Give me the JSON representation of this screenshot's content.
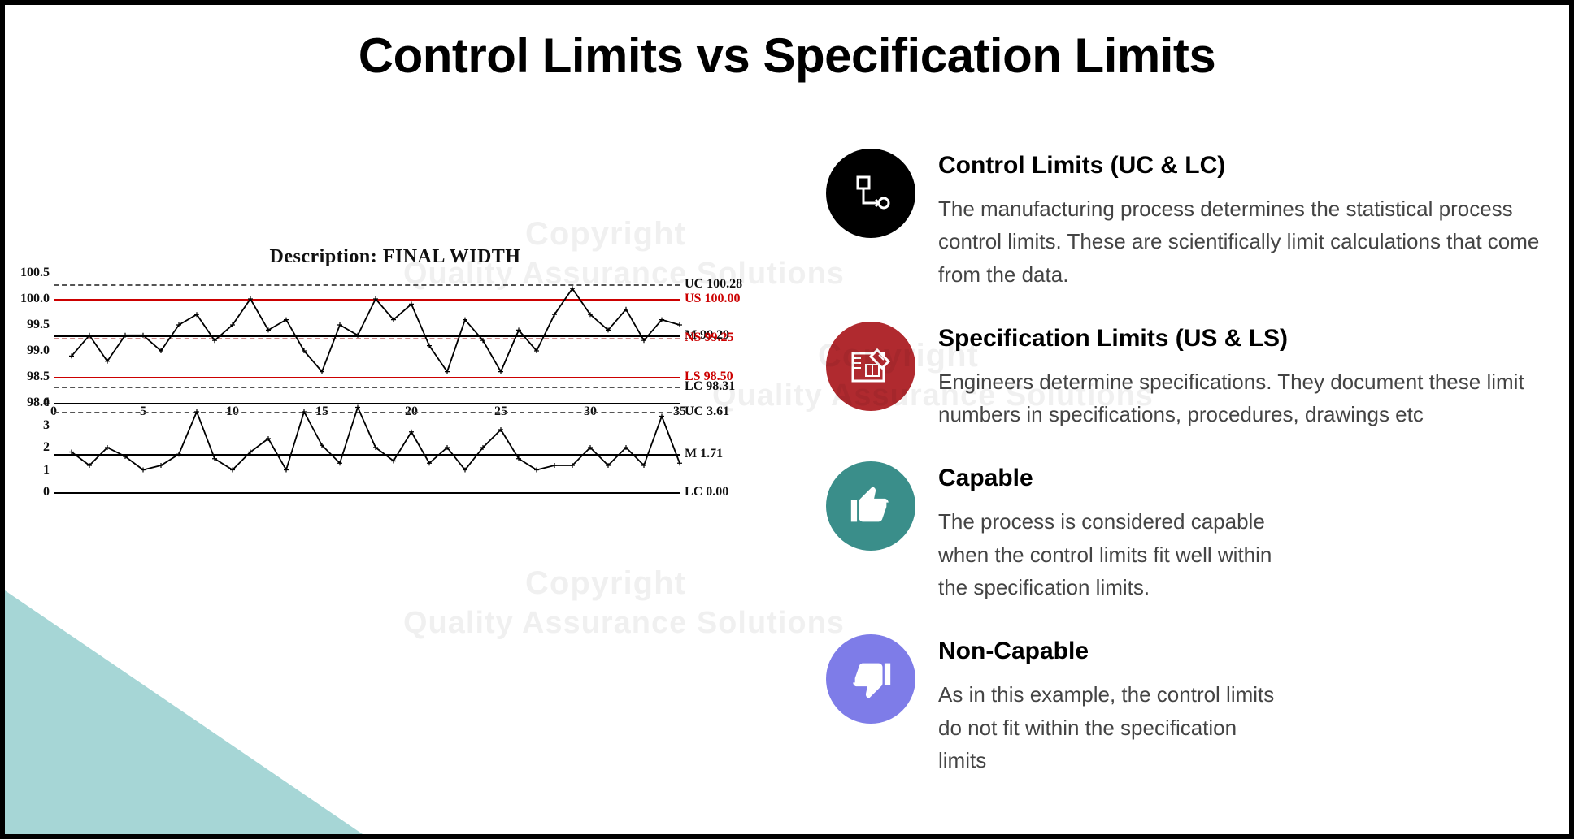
{
  "title": "Control Limits vs Specification Limits",
  "watermark": {
    "line1": "Copyright",
    "line2": "Quality Assurance Solutions"
  },
  "items": [
    {
      "icon": "flow-icon",
      "color": "ic-black",
      "title": "Control Limits (UC & LC)",
      "body": "The manufacturing process determines the statistical process control limits. These are scientifically limit calculations that come from the data."
    },
    {
      "icon": "blueprint-icon",
      "color": "ic-red",
      "title": "Specification Limits (US & LS)",
      "body": "Engineers determine specifications. They document these limit numbers in specifications, procedures, drawings etc"
    },
    {
      "icon": "thumbs-up-icon",
      "color": "ic-teal",
      "title": "Capable",
      "body": "The process is considered capable\nwhen the control limits fit well within\nthe specification limits."
    },
    {
      "icon": "thumbs-down-icon",
      "color": "ic-purple",
      "title": "Non-Capable",
      "body": "As in this example, the control limits\ndo not fit within the specification\nlimits"
    }
  ],
  "chart_data": {
    "title": "Description: FINAL WIDTH",
    "x_range": [
      0,
      35
    ],
    "x_ticks": [
      0,
      5,
      10,
      15,
      20,
      25,
      30,
      35
    ],
    "top_chart": {
      "type": "line",
      "ylim": [
        98.0,
        100.5
      ],
      "y_ticks": [
        98.0,
        98.5,
        99.0,
        99.5,
        100.0,
        100.5
      ],
      "ref_lines": {
        "UC": 100.28,
        "US": 100.0,
        "M": 99.29,
        "NS": 99.25,
        "LS": 98.5,
        "LC": 98.31
      },
      "right_labels": [
        {
          "text": "UC 100.28",
          "y": 100.28,
          "color": "black"
        },
        {
          "text": "US 100.00",
          "y": 100.0,
          "color": "red"
        },
        {
          "text": "M 99.29",
          "y": 99.29,
          "color": "black"
        },
        {
          "text": "NS 99.25",
          "y": 99.25,
          "color": "red"
        },
        {
          "text": "LS 98.50",
          "y": 98.5,
          "color": "red"
        },
        {
          "text": "LC 98.31",
          "y": 98.31,
          "color": "black"
        }
      ],
      "values": [
        98.9,
        99.3,
        98.8,
        99.3,
        99.3,
        99.0,
        99.5,
        99.7,
        99.2,
        99.5,
        100.0,
        99.4,
        99.6,
        99.0,
        98.6,
        99.5,
        99.3,
        100.0,
        99.6,
        99.9,
        99.1,
        98.6,
        99.6,
        99.2,
        98.6,
        99.4,
        99.0,
        99.7,
        100.2,
        99.7,
        99.4,
        99.8,
        99.2,
        99.6,
        99.5
      ]
    },
    "bottom_chart": {
      "type": "line",
      "ylim": [
        0,
        4
      ],
      "y_ticks": [
        0,
        1,
        2,
        3,
        4
      ],
      "ref_lines": {
        "UC": 3.61,
        "M": 1.71,
        "LC": 0.0
      },
      "right_labels": [
        {
          "text": "UC 3.61",
          "y": 3.61,
          "color": "black"
        },
        {
          "text": "M 1.71",
          "y": 1.71,
          "color": "black"
        },
        {
          "text": "LC 0.00",
          "y": 0.0,
          "color": "black"
        }
      ],
      "values": [
        1.8,
        1.2,
        2.0,
        1.6,
        1.0,
        1.2,
        1.7,
        3.6,
        1.5,
        1.0,
        1.8,
        2.4,
        1.0,
        3.6,
        2.1,
        1.3,
        3.8,
        2.0,
        1.4,
        2.7,
        1.3,
        2.0,
        1.0,
        2.0,
        2.8,
        1.5,
        1.0,
        1.2,
        1.2,
        2.0,
        1.2,
        2.0,
        1.2,
        3.4,
        1.3
      ]
    }
  }
}
